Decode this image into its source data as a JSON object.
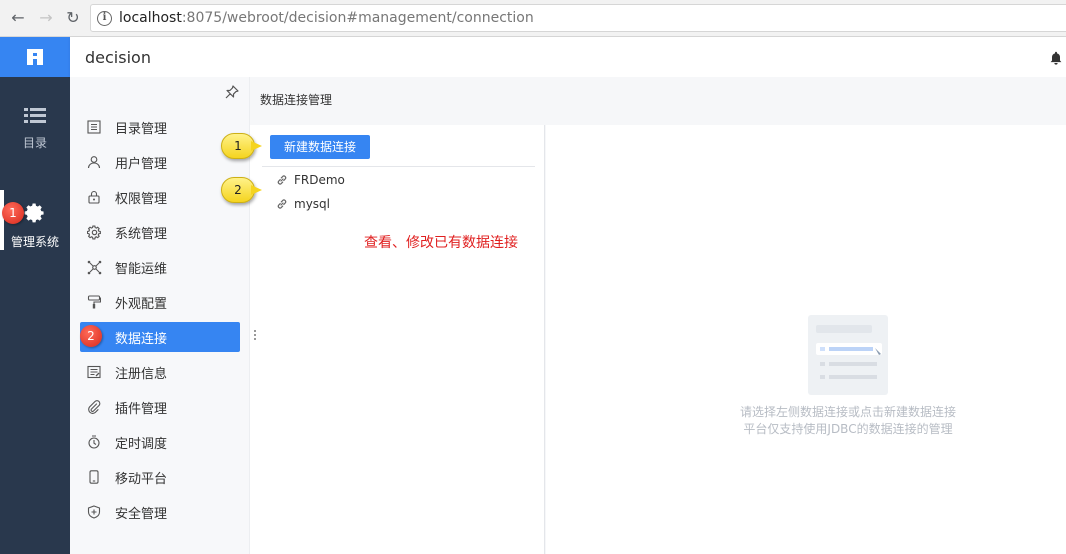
{
  "browser": {
    "url_host": "localhost",
    "url_rest": ":8075/webroot/decision#management/connection"
  },
  "app": {
    "title": "decision"
  },
  "rail": {
    "items": [
      {
        "label": "目录",
        "icon": "list-icon"
      },
      {
        "label": "管理系统",
        "icon": "gear-icon",
        "active": true
      }
    ],
    "badge": "1"
  },
  "menu": {
    "items": [
      {
        "label": "目录管理",
        "icon": "directory-icon"
      },
      {
        "label": "用户管理",
        "icon": "user-icon"
      },
      {
        "label": "权限管理",
        "icon": "lock-icon"
      },
      {
        "label": "系统管理",
        "icon": "gear-icon"
      },
      {
        "label": "智能运维",
        "icon": "network-icon"
      },
      {
        "label": "外观配置",
        "icon": "paint-roller-icon"
      },
      {
        "label": "数据连接",
        "icon": "connection-icon",
        "active": true
      },
      {
        "label": "注册信息",
        "icon": "register-icon"
      },
      {
        "label": "插件管理",
        "icon": "paperclip-icon"
      },
      {
        "label": "定时调度",
        "icon": "timer-icon"
      },
      {
        "label": "移动平台",
        "icon": "mobile-icon"
      },
      {
        "label": "安全管理",
        "icon": "shield-icon"
      }
    ],
    "badge": "2"
  },
  "content": {
    "page_title": "数据连接管理",
    "new_button": "新建数据连接",
    "connections": [
      "FRDemo",
      "mysql"
    ],
    "annotation": "查看、修改已有数据连接",
    "callouts": [
      "1",
      "2"
    ],
    "empty_line1": "请选择左侧数据连接或点击新建数据连接",
    "empty_line2": "平台仅支持使用JDBC的数据连接的管理"
  },
  "colors": {
    "accent": "#3685f2",
    "rail": "#29384d",
    "annotation": "#e02020"
  }
}
